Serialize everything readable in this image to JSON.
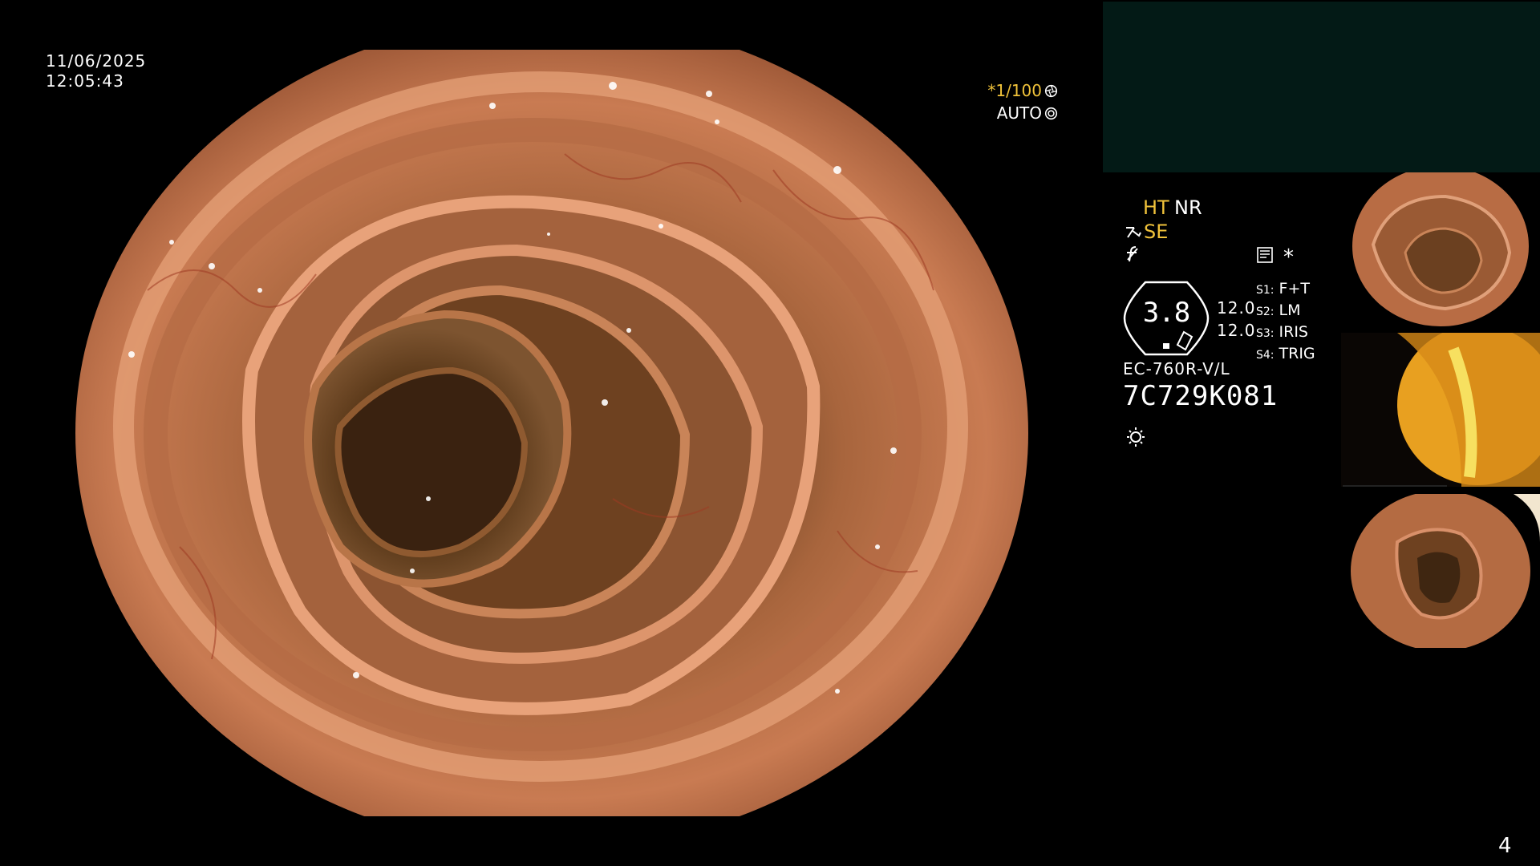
{
  "screen": {
    "date": "11/06/2025",
    "time": "12:05:43",
    "page_number": "4"
  },
  "exposure": {
    "shutter": "*1/100",
    "mode": "AUTO",
    "shutter_icon": "aperture-icon",
    "mode_icon": "auto-ring-icon"
  },
  "panel": {
    "ht_label": "HT",
    "nr_label": "NR",
    "se_label": "SE",
    "star_label": "*",
    "gauge_value": "3.8",
    "value_1": "12.0",
    "value_2": "12.0",
    "switches": [
      {
        "key": "S1:",
        "value": "F+T"
      },
      {
        "key": "S2:",
        "value": "LM"
      },
      {
        "key": "S3:",
        "value": "IRIS"
      },
      {
        "key": "S4:",
        "value": "TRIG"
      }
    ],
    "scope_model": "EC-760R-V/L",
    "serial_number": "7C729K081"
  },
  "colors": {
    "accent_yellow": "#f0c23a",
    "panel_dark": "#031a16",
    "mucosa": "#c9714a"
  },
  "thumbnails": [
    {
      "name": "colon-view-1"
    },
    {
      "name": "yellow-view-2"
    },
    {
      "name": "colon-view-3"
    }
  ]
}
